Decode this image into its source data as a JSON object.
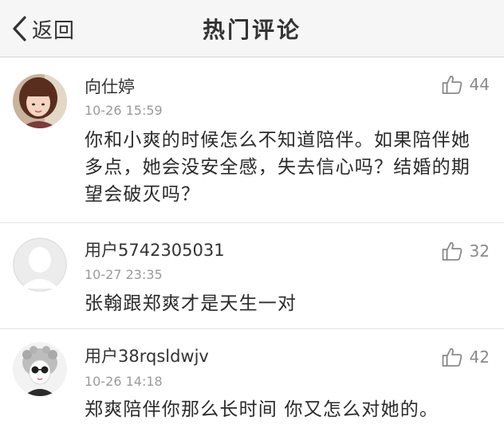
{
  "nav": {
    "back_label": "返回",
    "title": "热门评论"
  },
  "comments": [
    {
      "username": "向仕婷",
      "time": "10-26 15:59",
      "text": "你和小爽的时候怎么不知道陪伴。如果陪伴她多点，她会没安全感，失去信心吗？结婚的期望会破灭吗？",
      "likes": "44"
    },
    {
      "username": "用户5742305031",
      "time": "10-27 23:35",
      "text": "张翰跟郑爽才是天生一对",
      "likes": "32"
    },
    {
      "username": "用户38rqsldwjv",
      "time": "10-26 14:18",
      "text": "郑爽陪伴你那么长时间 你又怎么对她的。",
      "likes": "42"
    }
  ]
}
